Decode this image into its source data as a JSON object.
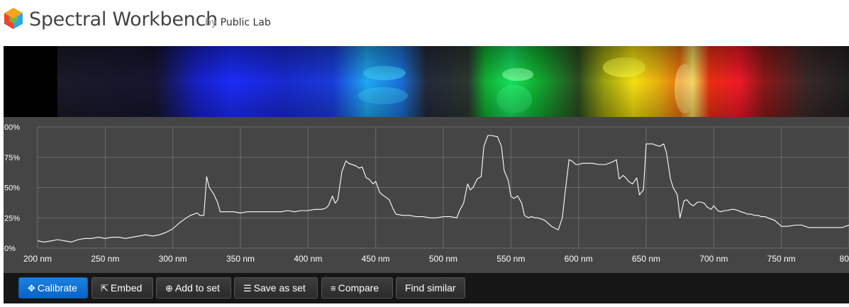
{
  "header": {
    "title": "Spectral Workbench",
    "by": "by",
    "org": "Public Lab",
    "logo_colors": [
      "#e8452c",
      "#f4a31a",
      "#7cb83e",
      "#2aa8e0",
      "#5b5bc8"
    ]
  },
  "spectrum_image": {
    "description_colors": [
      "#000000",
      "#1a1a2a",
      "#1a2cf0",
      "#22b8f0",
      "#10d040",
      "#f0e010",
      "#f07010",
      "#f01020",
      "#3a2a28"
    ]
  },
  "toolbar": {
    "calibrate_label": "Calibrate",
    "embed_label": "Embed",
    "add_to_set_label": "Add to set",
    "save_as_set_label": "Save as set",
    "compare_label": "Compare",
    "find_similar_label": "Find similar"
  },
  "chart_data": {
    "type": "line",
    "x_unit": "nm",
    "xlim": [
      200,
      800
    ],
    "ylim": [
      0,
      100
    ],
    "x_ticks": [
      "200 nm",
      "250 nm",
      "300 nm",
      "350 nm",
      "400 nm",
      "450 nm",
      "500 nm",
      "550 nm",
      "600 nm",
      "650 nm",
      "700 nm",
      "750 nm",
      "80"
    ],
    "y_ticks": [
      "0%",
      "25%",
      "50%",
      "75%",
      "00%"
    ],
    "grid": true,
    "line_color": "#ffffff",
    "series": [
      {
        "x": [
          200,
          205,
          210,
          215,
          220,
          225,
          230,
          235,
          240,
          245,
          250,
          255,
          260,
          265,
          270,
          275,
          280,
          285,
          290,
          295,
          300,
          305,
          310,
          313,
          318,
          320,
          323,
          325,
          327,
          330,
          333,
          335,
          340,
          345,
          350,
          355,
          360,
          365,
          370,
          375,
          380,
          385,
          390,
          395,
          400,
          405,
          410,
          413,
          415,
          418,
          420,
          422,
          425,
          428,
          430,
          435,
          438,
          440,
          443,
          445,
          448,
          450,
          453,
          455,
          460,
          463,
          465,
          470,
          475,
          480,
          485,
          490,
          495,
          500,
          505,
          510,
          512,
          515,
          518,
          520,
          522,
          525,
          528,
          530,
          533,
          535,
          540,
          543,
          545,
          548,
          550,
          552,
          555,
          558,
          560,
          563,
          565,
          568,
          570,
          575,
          580,
          585,
          588,
          590,
          593,
          595,
          598,
          600,
          603,
          605,
          610,
          615,
          620,
          625,
          628,
          630,
          633,
          635,
          637,
          640,
          643,
          645,
          648,
          650,
          652,
          655,
          657,
          660,
          663,
          665,
          668,
          670,
          673,
          675,
          678,
          680,
          683,
          685,
          688,
          690,
          693,
          695,
          698,
          700,
          703,
          705,
          708,
          710,
          713,
          715,
          718,
          720,
          723,
          725,
          728,
          730,
          733,
          735,
          738,
          740,
          745,
          750,
          755,
          760,
          765,
          770,
          775,
          780,
          785,
          790,
          795,
          800
        ],
        "y": [
          6,
          5,
          6,
          7,
          6,
          5,
          7,
          8,
          8,
          9,
          8,
          9,
          9,
          8,
          9,
          10,
          11,
          10,
          11,
          13,
          16,
          21,
          25,
          27,
          29,
          27,
          27,
          59,
          50,
          45,
          38,
          30,
          30,
          30,
          29,
          30,
          30,
          30,
          30,
          30,
          30,
          31,
          30,
          31,
          31,
          32,
          32,
          33,
          35,
          43,
          37,
          40,
          63,
          72,
          70,
          68,
          66,
          67,
          58,
          57,
          53,
          55,
          46,
          44,
          40,
          32,
          28,
          27,
          27,
          26,
          26,
          25,
          25,
          26,
          26,
          25,
          31,
          37,
          53,
          48,
          50,
          57,
          59,
          84,
          93,
          93,
          92,
          84,
          64,
          56,
          43,
          41,
          43,
          37,
          27,
          25,
          26,
          25,
          25,
          23,
          18,
          15,
          25,
          45,
          73,
          72,
          69,
          69,
          70,
          70,
          70,
          69,
          69,
          71,
          73,
          57,
          60,
          58,
          55,
          53,
          58,
          44,
          48,
          86,
          86,
          86,
          85,
          84,
          86,
          79,
          57,
          50,
          44,
          25,
          39,
          40,
          36,
          35,
          38,
          38,
          37,
          34,
          32,
          35,
          31,
          30,
          31,
          31,
          32,
          32,
          31,
          30,
          29,
          28,
          28,
          27,
          27,
          26,
          26,
          25,
          23,
          18,
          18,
          19,
          19,
          17,
          17,
          17,
          17,
          17,
          17,
          19
        ]
      }
    ]
  }
}
